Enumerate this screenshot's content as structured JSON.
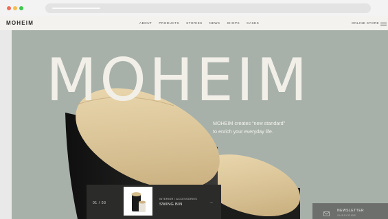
{
  "nav": {
    "logo": "MOHEIM",
    "items": [
      "ABOUT",
      "PRODUCTS",
      "STORIES",
      "NEWS",
      "SHOPS",
      "CASES"
    ],
    "online_store": "ONLINE STORE"
  },
  "hero": {
    "title": "MOHEIM",
    "tagline_line1": "MOHEIM creates “new standard”",
    "tagline_line2": "to enrich your everyday life."
  },
  "slide": {
    "counter": "01  /  03",
    "category": "INTERIOR / ACCESSORIES",
    "title": "SWING BIN",
    "arrow": "→"
  },
  "newsletter": {
    "title": "NEWSLETTER",
    "subtitle": "SUBSCRIBE"
  },
  "colors": {
    "hero_background": "#a7b1aa",
    "hero_text": "#f1efe7",
    "header_background": "#f4f2ee",
    "bin_black": "#1b1b1a",
    "wood": "#d9c398"
  },
  "icons": {
    "menu": "hamburger-menu-icon",
    "mail": "mail-icon",
    "arrow": "arrow-right-icon"
  }
}
